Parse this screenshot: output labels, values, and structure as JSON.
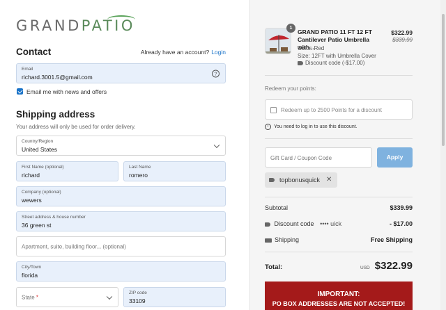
{
  "logo": {
    "part1": "GRAND",
    "part2": "PATIO"
  },
  "contact": {
    "title": "Contact",
    "already_text": "Already have an account?",
    "login_label": "Login",
    "email_label": "Email",
    "email_value": "richard.3001.5@gmail.com",
    "news_label": "Email me with news and offers"
  },
  "shipping": {
    "title": "Shipping address",
    "subtitle": "Your address will only be used for order delivery.",
    "country_label": "Country/Region",
    "country_value": "United States",
    "first_label": "First Name (optional)",
    "first_value": "richard",
    "last_label": "Last Name",
    "last_value": "romero",
    "company_label": "Company (optional)",
    "company_value": "wewers",
    "street_label": "Street address & house number",
    "street_value": "36 green st",
    "apt_placeholder": "Apartment, suite, building floor... (optional)",
    "city_label": "City/Town",
    "city_value": "florida",
    "state_placeholder": "State",
    "zip_label": "ZIP code",
    "zip_value": "33109"
  },
  "order": {
    "qty": "1",
    "product_name": "GRAND PATIO 11 FT 12 FT Cantilever Patio Umbrella with...",
    "color": "Color: Red",
    "size": "Size: 12FT with Umbrella Cover",
    "discount_line": "Discount code (-$17.00)",
    "price": "$322.99",
    "old_price": "$339.99"
  },
  "points": {
    "title": "Redeem your points:",
    "option": "Redeem up to 2500 Points for a  discount",
    "note": "You need to log in to use this discount."
  },
  "coupon": {
    "placeholder": "Gift Card / Coupon Code",
    "apply_label": "Apply",
    "applied_code": "topbonusquick"
  },
  "summary": {
    "subtotal_label": "Subtotal",
    "subtotal_value": "$339.99",
    "discount_label": "Discount code",
    "discount_code": "•••• uick",
    "discount_value": "- $17.00",
    "shipping_label": "Shipping",
    "shipping_value": "Free Shipping",
    "total_label": "Total:",
    "currency": "USD",
    "total_value": "$322.99"
  },
  "banner": {
    "line1": "IMPORTANT:",
    "line2": "PO BOX ADDRESSES ARE NOT ACCEPTED!"
  },
  "colors": {
    "accent": "#1a73c8",
    "apply_button": "#7fb2df",
    "autofill_bg": "#e8f0fb",
    "banner": "#a41a1a"
  }
}
